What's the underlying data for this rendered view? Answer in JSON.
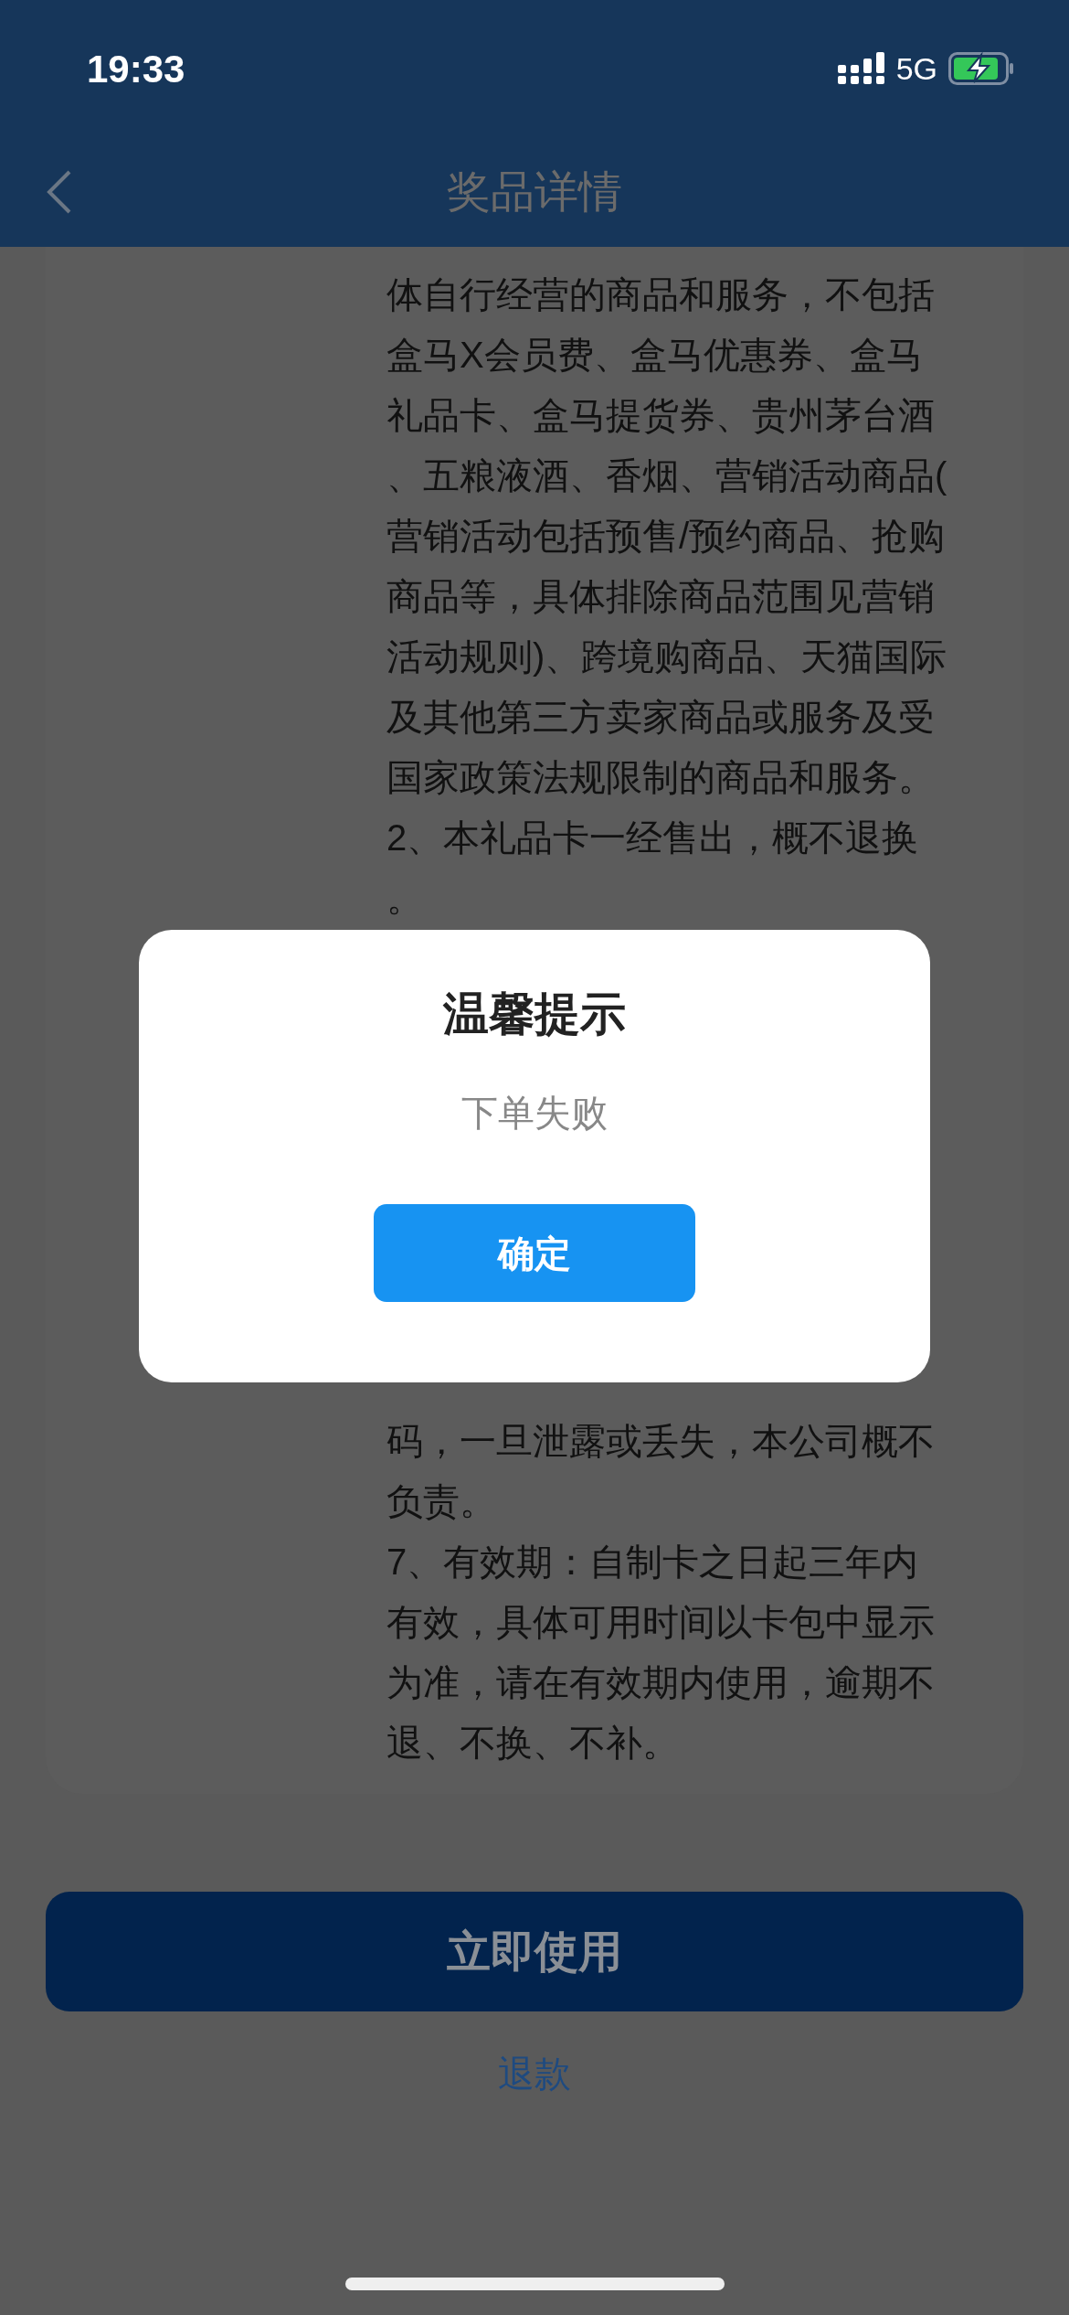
{
  "status_bar": {
    "time": "19:33",
    "network": "5G"
  },
  "header": {
    "title": "奖品详情"
  },
  "terms": {
    "lines_above": [
      "体自行经营的商品和服务，不包括",
      "盒马X会员费、盒马优惠券、盒马",
      "礼品卡、盒马提货券、贵州茅台酒",
      "、五粮液酒、香烟、营销活动商品(",
      "营销活动包括预售/预约商品、抢购",
      "商品等，具体排除商品范围见营销",
      "活动规则)、跨境购商品、天猫国际",
      "及其他第三方卖家商品或服务及受",
      "国家政策法规限制的商品和服务。",
      "2、本礼品卡一经售出，概不退换",
      "。"
    ],
    "lines_below": [
      "码，一旦泄露或丢失，本公司概不",
      "负责。",
      "7、有效期：自制卡之日起三年内",
      "有效，具体可用时间以卡包中显示",
      "为准，请在有效期内使用，逾期不",
      "退、不换、不补。"
    ]
  },
  "use_button": "立即使用",
  "refund_link": "退款",
  "dialog": {
    "title": "温馨提示",
    "message": "下单失败",
    "confirm": "确定"
  }
}
